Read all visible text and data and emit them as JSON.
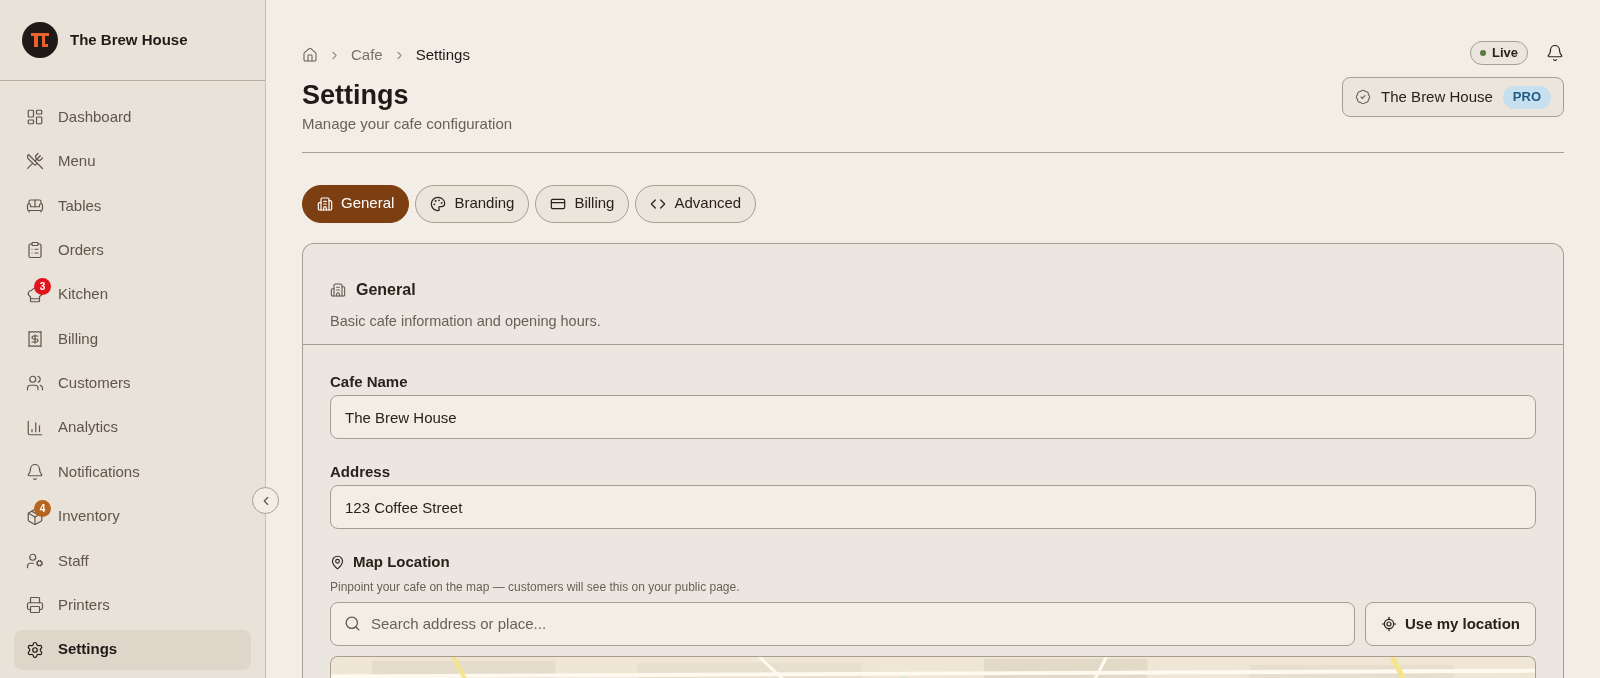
{
  "sidebar": {
    "brand": "The Brew House",
    "items": [
      {
        "label": "Dashboard",
        "selected": false
      },
      {
        "label": "Menu",
        "selected": false
      },
      {
        "label": "Tables",
        "selected": false
      },
      {
        "label": "Orders",
        "selected": false
      },
      {
        "label": "Kitchen",
        "selected": false,
        "badge": {
          "text": "3",
          "color": "#e0141c"
        }
      },
      {
        "label": "Billing",
        "selected": false
      },
      {
        "label": "Customers",
        "selected": false
      },
      {
        "label": "Analytics",
        "selected": false
      },
      {
        "label": "Notifications",
        "selected": false
      },
      {
        "label": "Inventory",
        "selected": false,
        "badge": {
          "text": "4",
          "color": "#b5651d"
        }
      },
      {
        "label": "Staff",
        "selected": false
      },
      {
        "label": "Printers",
        "selected": false
      },
      {
        "label": "Settings",
        "selected": true
      }
    ]
  },
  "breadcrumb": [
    "Cafe",
    "Settings"
  ],
  "status": "Live",
  "header": {
    "title": "Settings",
    "subtitle": "Manage your cafe configuration",
    "account": {
      "name": "The Brew House",
      "plan": "PRO"
    }
  },
  "tabs": [
    {
      "label": "General",
      "selected": true
    },
    {
      "label": "Branding",
      "selected": false
    },
    {
      "label": "Billing",
      "selected": false
    },
    {
      "label": "Advanced",
      "selected": false
    }
  ],
  "card": {
    "title": "General",
    "description": "Basic cafe information and opening hours.",
    "fields": [
      {
        "label": "Cafe Name",
        "value": "The Brew House"
      },
      {
        "label": "Address",
        "value": "123 Coffee Street"
      }
    ],
    "map": {
      "label": "Map Location",
      "hint": "Pinpoint your cafe on the map — customers will see this on your public page.",
      "search_placeholder": "Search address or place...",
      "button": "Use my location"
    }
  }
}
